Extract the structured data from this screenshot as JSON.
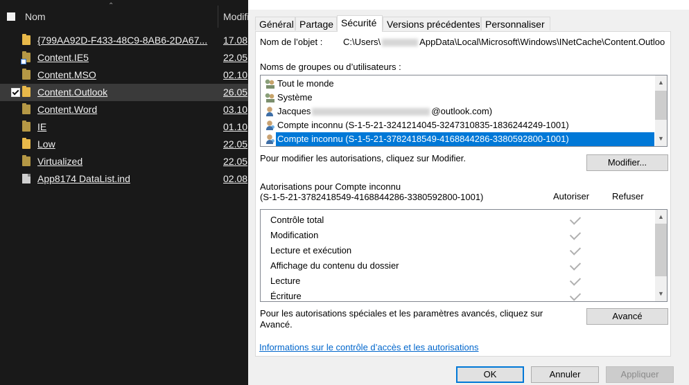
{
  "explorer": {
    "header": {
      "name": "Nom",
      "modified": "Modifi"
    },
    "rows": [
      {
        "name": "{799AA92D-F433-48C9-8AB6-2DA67...",
        "date": "17.08"
      },
      {
        "name": "Content.IE5",
        "date": "22.05"
      },
      {
        "name": "Content.MSO",
        "date": "02.10"
      },
      {
        "name": "Content.Outlook",
        "date": "26.05"
      },
      {
        "name": "Content.Word",
        "date": "03.10"
      },
      {
        "name": "IE",
        "date": "01.10"
      },
      {
        "name": "Low",
        "date": "22.05"
      },
      {
        "name": "Virtualized",
        "date": "22.05"
      },
      {
        "name": "App8174 DataList.ind",
        "date": "02.08"
      }
    ]
  },
  "dialog": {
    "tabs": [
      "Général",
      "Partage",
      "Sécurité",
      "Versions précédentes",
      "Personnaliser"
    ],
    "object_label": "Nom de l’objet :",
    "object_path_pre": "C:\\Users\\",
    "object_path_post": "AppData\\Local\\Microsoft\\Windows\\INetCache\\Content.Outloo",
    "groups_label": "Noms de groupes ou d’utilisateurs :",
    "users": [
      {
        "pre": "Tout le monde",
        "post": ""
      },
      {
        "pre": "Système",
        "post": ""
      },
      {
        "pre": "Jacques",
        "post": "@outlook.com)"
      },
      {
        "pre": "Compte inconnu (S-1-5-21-3241214045-3247310835-1836244249-1001)",
        "post": ""
      },
      {
        "pre": "Compte inconnu (S-1-5-21-3782418549-4168844286-3380592800-1001)",
        "post": ""
      }
    ],
    "modify_hint": "Pour modifier les autorisations, cliquez sur Modifier.",
    "modify_button": "Modifier...",
    "perm_header_1": "Autorisations pour Compte inconnu",
    "perm_header_2": "(S-1-5-21-3782418549-4168844286-3380592800-1001)",
    "allow_label": "Autoriser",
    "deny_label": "Refuser",
    "permissions": [
      "Contrôle total",
      "Modification",
      "Lecture et exécution",
      "Affichage du contenu du dossier",
      "Lecture",
      "Écriture"
    ],
    "advanced_hint_1": "Pour les autorisations spéciales et les paramètres avancés, cliquez sur",
    "advanced_hint_2": "Avancé.",
    "advanced_button": "Avancé",
    "help_link": "Informations sur le contrôle d’accès et les autorisations",
    "ok_button": "OK",
    "cancel_button": "Annuler",
    "apply_button": "Appliquer"
  }
}
